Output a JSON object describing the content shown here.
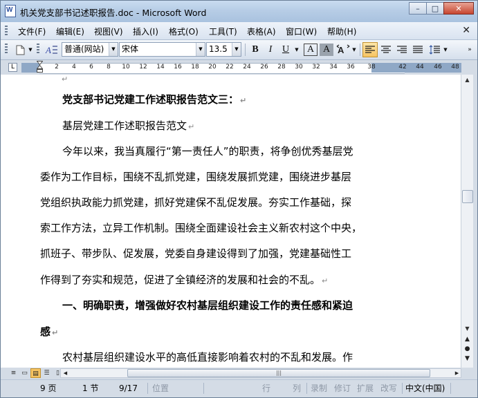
{
  "window": {
    "title": "机关党支部书记述职报告.doc - Microsoft Word",
    "buttons": {
      "minimize": "–",
      "maximize": "□",
      "close": "✕"
    }
  },
  "menubar": {
    "items": [
      "文件(F)",
      "编辑(E)",
      "视图(V)",
      "插入(I)",
      "格式(O)",
      "工具(T)",
      "表格(A)",
      "窗口(W)",
      "帮助(H)"
    ],
    "close_glyph": "✕"
  },
  "toolbar": {
    "style_value": "普通(网站)",
    "font_value": "宋体",
    "size_value": "13.5",
    "bold": "B",
    "italic": "I",
    "underline": "U",
    "char_border": "A",
    "char_shading": "A",
    "arrow_glyph": "▼"
  },
  "ruler": {
    "corner": "L",
    "numbers": [
      "2",
      "4",
      "6",
      "8",
      "10",
      "12",
      "14",
      "16",
      "18",
      "20",
      "22",
      "24",
      "26",
      "28",
      "30",
      "32",
      "34",
      "36",
      "38",
      "42",
      "44",
      "46",
      "48"
    ]
  },
  "document": {
    "paragraphs": [
      {
        "text": "党支部书记党建工作述职报告范文三：",
        "bold": true,
        "mark": "↵"
      },
      {
        "text": "基层党建工作述职报告范文",
        "bold": false,
        "mark": "↵"
      },
      {
        "text": "今年以来，我当真履行“第一责任人”的职责，将争创优秀基层党",
        "bold": false,
        "mark": ""
      },
      {
        "text": "委作为工作目标，围绕不乱抓党建，围绕发展抓党建，围绕进步基层",
        "bold": false,
        "mark": ""
      },
      {
        "text": "党组织执政能力抓党建，抓好党建保不乱促发展。夯实工作基础，探",
        "bold": false,
        "mark": ""
      },
      {
        "text": "索工作方法，立异工作机制。围绕全面建设社会主义新农村这个中央，",
        "bold": false,
        "mark": ""
      },
      {
        "text": "抓班子、带步队、促发展，党委自身建设得到了加强，党建基础性工",
        "bold": false,
        "mark": ""
      },
      {
        "text": "作得到了夯实和规范，促进了全镇经济的发展和社会的不乱。",
        "bold": false,
        "mark": "↵"
      },
      {
        "text": "一、明确职责，增强做好农村基层组织建设工作的责任感和紧迫",
        "bold": true,
        "mark": ""
      },
      {
        "text": "感",
        "bold": true,
        "mark": "↵"
      },
      {
        "text": "农村基层组织建设水平的高低直接影响着农村的不乱和发展。作",
        "bold": false,
        "mark": ""
      }
    ]
  },
  "statusbar": {
    "page": "9 页",
    "section": "1 节",
    "page_of": "9/17",
    "position": "位置",
    "line": "行",
    "column": "列",
    "record": "录制",
    "revise": "修订",
    "extend": "扩展",
    "overwrite": "改写",
    "language": "中文(中国)"
  }
}
